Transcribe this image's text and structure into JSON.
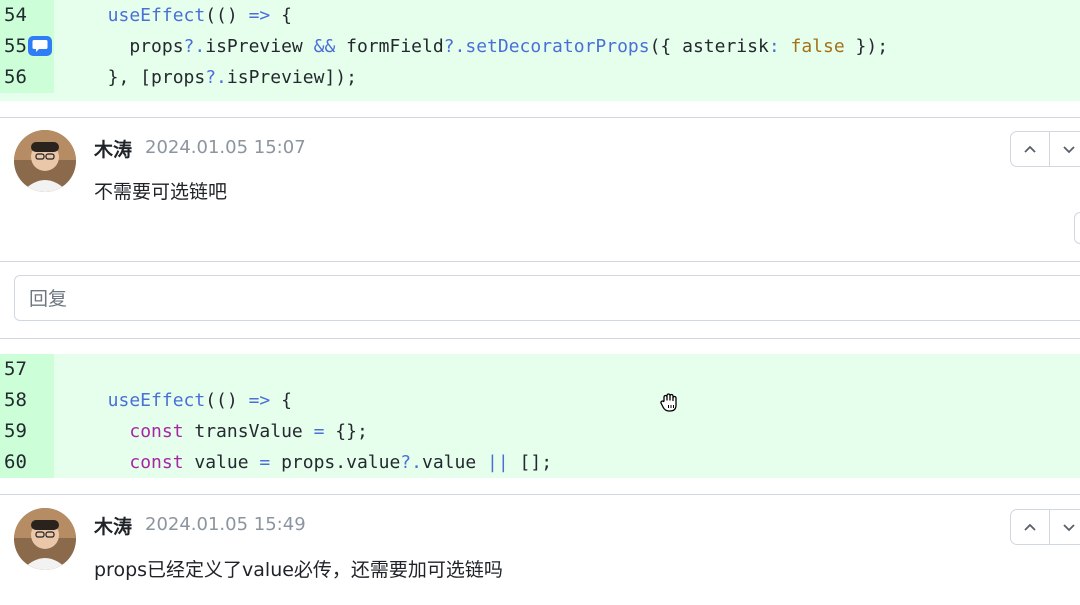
{
  "code_block_1": {
    "lines": [
      {
        "number": "54",
        "tokens": [
          {
            "t": "  useEffect",
            "c": "k"
          },
          {
            "t": "(() ",
            "c": ""
          },
          {
            "t": "=>",
            "c": "op"
          },
          {
            "t": " {",
            "c": ""
          }
        ]
      },
      {
        "number": "55",
        "tokens": [
          {
            "t": "    props",
            "c": ""
          },
          {
            "t": "?.",
            "c": "op"
          },
          {
            "t": "isPreview ",
            "c": ""
          },
          {
            "t": "&&",
            "c": "op"
          },
          {
            "t": " formField",
            "c": ""
          },
          {
            "t": "?.",
            "c": "op"
          },
          {
            "t": "setDecoratorProps",
            "c": "k"
          },
          {
            "t": "({ asterisk",
            "c": ""
          },
          {
            "t": ":",
            "c": "op"
          },
          {
            "t": " ",
            "c": ""
          },
          {
            "t": "false",
            "c": "bool"
          },
          {
            "t": " });",
            "c": ""
          }
        ]
      },
      {
        "number": "56",
        "tokens": [
          {
            "t": "  }, [props",
            "c": ""
          },
          {
            "t": "?.",
            "c": "op"
          },
          {
            "t": "isPreview]);",
            "c": ""
          }
        ]
      }
    ],
    "comment_marker_icon": "comment-bubble-icon"
  },
  "comment_1": {
    "author": "木涛",
    "timestamp": "2024.01.05 15:07",
    "body": "不需要可选链吧",
    "nav_up_icon": "chevron-up-icon",
    "nav_down_icon": "chevron-down-icon"
  },
  "reply": {
    "placeholder": "回复"
  },
  "code_block_2": {
    "lines": [
      {
        "number": "57",
        "tokens": []
      },
      {
        "number": "58",
        "tokens": [
          {
            "t": "  useEffect",
            "c": "k"
          },
          {
            "t": "(() ",
            "c": ""
          },
          {
            "t": "=>",
            "c": "op"
          },
          {
            "t": " {",
            "c": ""
          }
        ]
      },
      {
        "number": "59",
        "tokens": [
          {
            "t": "    ",
            "c": ""
          },
          {
            "t": "const",
            "c": "kw"
          },
          {
            "t": " transValue ",
            "c": ""
          },
          {
            "t": "=",
            "c": "op"
          },
          {
            "t": " {};",
            "c": ""
          }
        ]
      },
      {
        "number": "60",
        "tokens": [
          {
            "t": "    ",
            "c": ""
          },
          {
            "t": "const",
            "c": "kw"
          },
          {
            "t": " value ",
            "c": ""
          },
          {
            "t": "=",
            "c": "op"
          },
          {
            "t": " props.value",
            "c": ""
          },
          {
            "t": "?.",
            "c": "op"
          },
          {
            "t": "value ",
            "c": ""
          },
          {
            "t": "||",
            "c": "op"
          },
          {
            "t": " [];",
            "c": ""
          }
        ]
      }
    ]
  },
  "comment_2": {
    "author": "木涛",
    "timestamp": "2024.01.05 15:49",
    "body": "props已经定义了value必传，还需要加可选链吗",
    "nav_up_icon": "chevron-up-icon",
    "nav_down_icon": "chevron-down-icon"
  },
  "cursor_icon": "grab-hand-cursor-icon",
  "colors": {
    "added_line_bg": "#e6ffec",
    "added_gutter_bg": "#ccffd8",
    "accent_blue": "#2f7df6"
  }
}
